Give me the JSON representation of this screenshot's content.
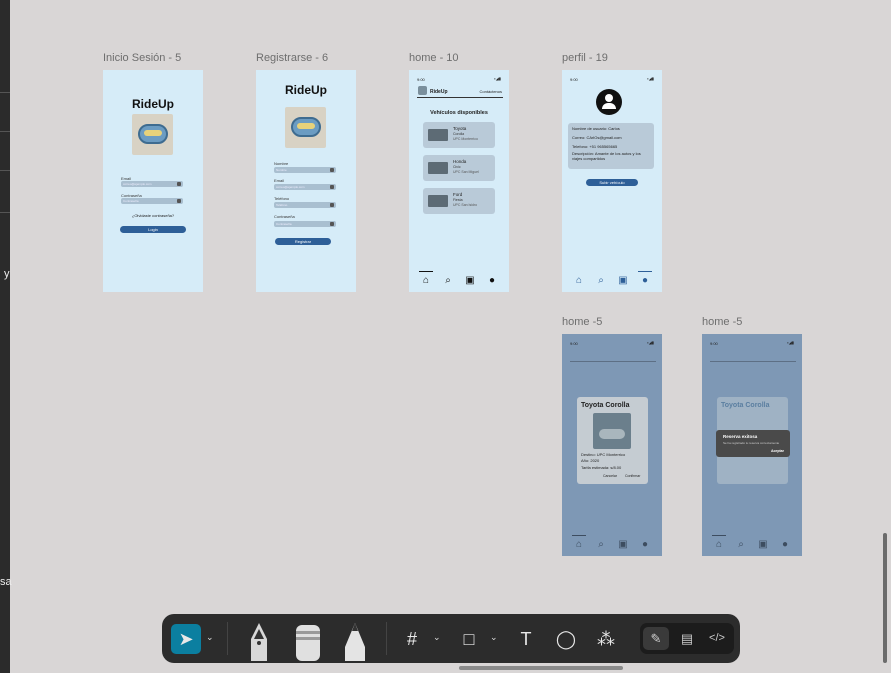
{
  "canvas": {
    "left_rail_texts": [
      "y",
      "sa"
    ]
  },
  "frames": {
    "login": {
      "label": "Inicio Sesión - 5",
      "title": "RideUp",
      "email_label": "Email",
      "email_placeholder": "correo@ejemplo.com",
      "password_label": "Contraseña",
      "password_placeholder": "Contraseña",
      "forgot": "¿Olvidaste contraseña?",
      "login_button": "Login"
    },
    "register": {
      "label": "Registrarse - 6",
      "title": "RideUp",
      "fields": [
        {
          "label": "Nombre",
          "placeholder": "Nombre"
        },
        {
          "label": "Email",
          "placeholder": "correo@ejemplo.com"
        },
        {
          "label": "Teléfono",
          "placeholder": "Teléfono"
        },
        {
          "label": "Contraseña",
          "placeholder": "Contraseña"
        }
      ],
      "register_button": "Registrar"
    },
    "home": {
      "label": "home - 10",
      "time": "9:00",
      "brand": "RideUp",
      "top_link": "Contáctenos",
      "section_title": "Vehículos disponibles",
      "cards": [
        {
          "title": "Toyota",
          "model": "Corolla",
          "place": "UPC Monterrico"
        },
        {
          "title": "Honda",
          "model": "Civic",
          "place": "UPC San Miguel"
        },
        {
          "title": "Ford",
          "model": "Fiesta",
          "place": "UPC San Isidro"
        }
      ]
    },
    "profile": {
      "label": "perfil - 19",
      "time": "9:00",
      "lines": [
        "Nombre de usuario: Carlos",
        "Correo: CArlOs@gmail.com",
        "Telefono: +51 965565665",
        "Descripción: Amante de los autos y los viajes compartidos"
      ],
      "add_button": "Subir vehículo"
    },
    "home_modal": {
      "label": "home -5",
      "time": "9:00",
      "car_title": "Toyota Corolla",
      "details": [
        "Destino: UPC Monterrico",
        "Año: 2020",
        "Tarifa estimada: s/8.00"
      ],
      "cancel": "Cancelar",
      "confirm": "Confirmar"
    },
    "home_success": {
      "label": "home -5",
      "time": "9:00",
      "car_title": "Toyota Corolla",
      "dialog_title": "Reserva exitosa",
      "dialog_text": "Se ha registrado tu reserva correctamente",
      "dialog_button": "Aceptar"
    }
  },
  "toolbar": {
    "tools": [
      "move-tool",
      "pen-tool",
      "marker-tool",
      "pencil-tool",
      "frame-tool",
      "shape-tool",
      "text-tool",
      "comment-tool",
      "actions-tool"
    ],
    "modes": [
      "draw-mode",
      "design-mode",
      "dev-mode"
    ],
    "glyphs": {
      "move": "➤",
      "frame": "#",
      "shape": "□",
      "text": "T",
      "comment": "◯",
      "actions": "⁂",
      "caret": "⌄",
      "draw": "✎",
      "design": "▤",
      "dev": "</>"
    },
    "accent": "#0b7fa0"
  },
  "colors": {
    "canvas_bg": "#d9d6d6",
    "frame_bg": "#d6ecf8",
    "primary_button": "#2e5f98",
    "card_bg": "#b9cad8"
  }
}
